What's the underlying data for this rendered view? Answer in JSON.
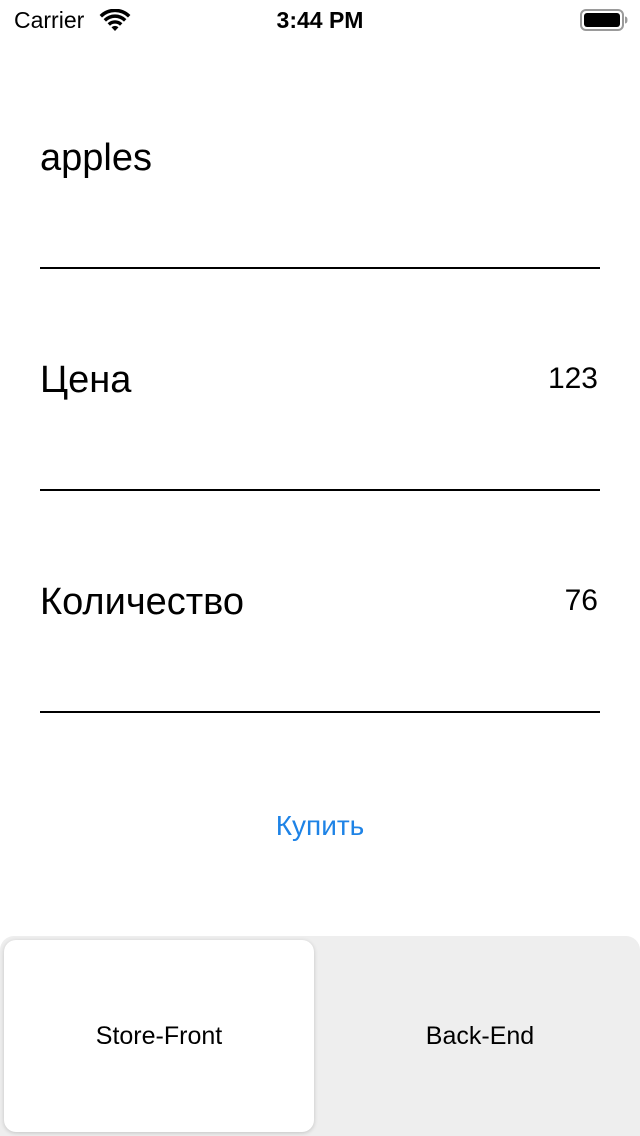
{
  "status_bar": {
    "carrier": "Carrier",
    "time": "3:44 PM",
    "wifi_icon": "wifi-icon",
    "battery_icon": "battery-full-icon"
  },
  "product": {
    "name": "apples"
  },
  "price": {
    "label": "Цена",
    "value": "123"
  },
  "quantity": {
    "label": "Количество",
    "value": "76"
  },
  "buy_button": {
    "label": "Купить",
    "color": "#1e83e6"
  },
  "tabs": [
    {
      "label": "Store-Front",
      "selected": true
    },
    {
      "label": "Back-End",
      "selected": false
    }
  ]
}
